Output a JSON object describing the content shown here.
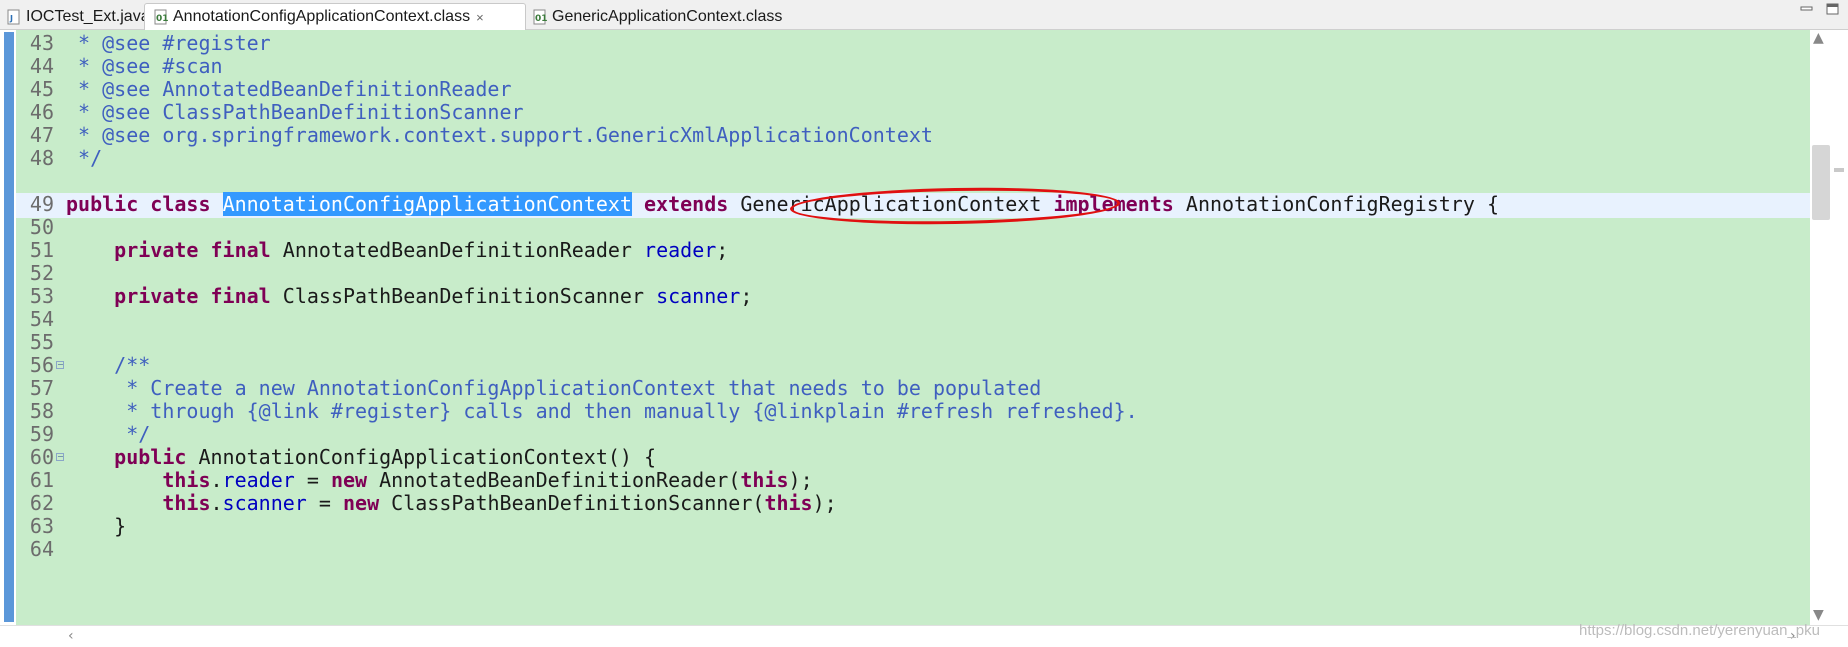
{
  "tabs": [
    {
      "label": "IOCTest_Ext.java",
      "icon": "java-file-icon",
      "active": false
    },
    {
      "label": "AnnotationConfigApplicationContext.class",
      "icon": "class-file-icon",
      "active": true,
      "close": "×"
    },
    {
      "label": "GenericApplicationContext.class",
      "icon": "class-file-icon",
      "active": false
    }
  ],
  "editor": {
    "lines": [
      {
        "n": "43",
        "text": " * @see #register"
      },
      {
        "n": "44",
        "text": " * @see #scan"
      },
      {
        "n": "45",
        "text": " * @see AnnotatedBeanDefinitionReader"
      },
      {
        "n": "46",
        "text": " * @see ClassPathBeanDefinitionScanner"
      },
      {
        "n": "47",
        "text": " * @see org.springframework.context.support.GenericXmlApplicationContext"
      },
      {
        "n": "48",
        "text": " */"
      },
      {
        "n": "49",
        "text": "public class AnnotationConfigApplicationContext extends GenericApplicationContext implements AnnotationConfigRegistry {"
      },
      {
        "n": "50",
        "text": ""
      },
      {
        "n": "51",
        "text": "    private final AnnotatedBeanDefinitionReader reader;"
      },
      {
        "n": "52",
        "text": ""
      },
      {
        "n": "53",
        "text": "    private final ClassPathBeanDefinitionScanner scanner;"
      },
      {
        "n": "54",
        "text": ""
      },
      {
        "n": "55",
        "text": ""
      },
      {
        "n": "56",
        "text": "    /**"
      },
      {
        "n": "57",
        "text": "     * Create a new AnnotationConfigApplicationContext that needs to be populated"
      },
      {
        "n": "58",
        "text": "     * through {@link #register} calls and then manually {@linkplain #refresh refreshed}."
      },
      {
        "n": "59",
        "text": "     */"
      },
      {
        "n": "60",
        "text": "    public AnnotationConfigApplicationContext() {"
      },
      {
        "n": "61",
        "text": "        this.reader = new AnnotatedBeanDefinitionReader(this);"
      },
      {
        "n": "62",
        "text": "        this.scanner = new ClassPathBeanDefinitionScanner(this);"
      },
      {
        "n": "63",
        "text": "    }"
      },
      {
        "n": "64",
        "text": ""
      }
    ],
    "fold_markers": [
      "56",
      "60"
    ],
    "selected_text": "AnnotationConfigApplicationContext",
    "circled_text": "GenericApplicationContext"
  },
  "colors": {
    "editor_bg": "#c8ecca",
    "current_line": "#e8f2fe",
    "keyword": "#7f0055",
    "comment": "#3f5fbf",
    "field": "#0000c0",
    "selection": "#3399ff",
    "annotation_circle": "#e01010"
  },
  "watermark": "https://blog.csdn.net/yerenyuan_pku"
}
